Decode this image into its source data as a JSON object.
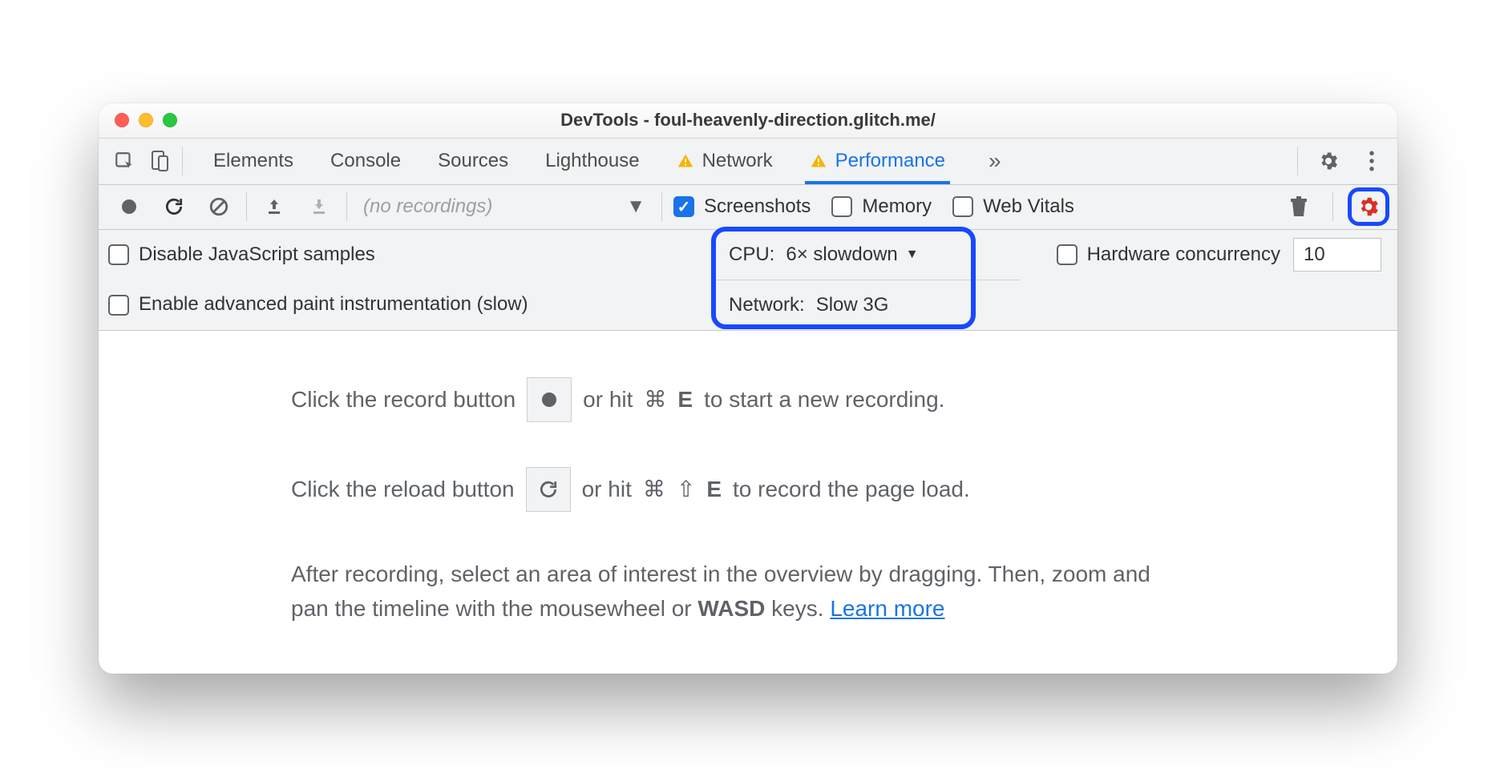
{
  "window": {
    "title": "DevTools - foul-heavenly-direction.glitch.me/"
  },
  "tabs": {
    "items": [
      "Elements",
      "Console",
      "Sources",
      "Lighthouse",
      "Network",
      "Performance"
    ],
    "active": "Performance",
    "more": "»"
  },
  "action_bar": {
    "recordings_placeholder": "(no recordings)",
    "screenshots_label": "Screenshots",
    "memory_label": "Memory",
    "webvitals_label": "Web Vitals"
  },
  "settings": {
    "disable_js_label": "Disable JavaScript samples",
    "enable_paint_label": "Enable advanced paint instrumentation (slow)",
    "cpu_label": "CPU:",
    "cpu_value": "6× slowdown",
    "network_label": "Network:",
    "network_value": "Slow 3G",
    "hc_label": "Hardware concurrency",
    "hc_value": "10"
  },
  "body": {
    "line1_a": "Click the record button",
    "line1_b": "or hit",
    "line1_cmd": "⌘",
    "line1_key": "E",
    "line1_c": "to start a new recording.",
    "line2_a": "Click the reload button",
    "line2_b": "or hit",
    "line2_cmd": "⌘",
    "line2_shift": "⇧",
    "line2_key": "E",
    "line2_c": "to record the page load.",
    "para_a": "After recording, select an area of interest in the overview by dragging. Then, zoom and pan the timeline with the mousewheel or ",
    "para_wasd": "WASD",
    "para_b": " keys. ",
    "learn_more": "Learn more"
  }
}
